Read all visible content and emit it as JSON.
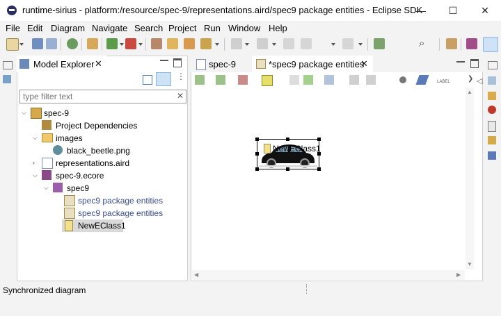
{
  "window": {
    "title": "runtime-sirius - platform:/resource/spec-9/representations.aird/spec9 package entities - Eclipse SDK",
    "minimize": "—",
    "maximize": "☐",
    "close": "✕"
  },
  "menu": [
    "File",
    "Edit",
    "Diagram",
    "Navigate",
    "Search",
    "Project",
    "Run",
    "Window",
    "Help"
  ],
  "explorer": {
    "tab_label": "Model Explorer",
    "filter_placeholder": "type filter text",
    "tree": [
      {
        "label": "spec-9",
        "level": 0,
        "expanded": true,
        "icon": "project-icon"
      },
      {
        "label": "Project Dependencies",
        "level": 1,
        "icon": "dependencies-icon"
      },
      {
        "label": "images",
        "level": 1,
        "expanded": true,
        "icon": "folder-icon"
      },
      {
        "label": "black_beetle.png",
        "level": 2,
        "icon": "image-file-icon"
      },
      {
        "label": "representations.aird",
        "level": 1,
        "expanded": false,
        "icon": "aird-file-icon"
      },
      {
        "label": "spec-9.ecore",
        "level": 1,
        "expanded": true,
        "icon": "ecore-file-icon"
      },
      {
        "label": "spec9",
        "level": 2,
        "expanded": true,
        "icon": "package-icon"
      },
      {
        "label": "spec9 package entities",
        "level": 3,
        "icon": "diagram-icon",
        "link": true
      },
      {
        "label": "spec9 package entities",
        "level": 3,
        "icon": "diagram-icon",
        "link": true
      },
      {
        "label": "NewEClass1",
        "level": 3,
        "icon": "eclass-icon",
        "selected": true
      }
    ]
  },
  "editor": {
    "tabs": [
      {
        "label": "spec-9",
        "active": false
      },
      {
        "label": "*spec9 package entities",
        "active": true
      }
    ],
    "node_label": "NewEClass1"
  },
  "status": {
    "text": "Synchronized diagram"
  },
  "colors": {
    "link": "#3a4f8f",
    "selection": "#d9d9d9"
  }
}
